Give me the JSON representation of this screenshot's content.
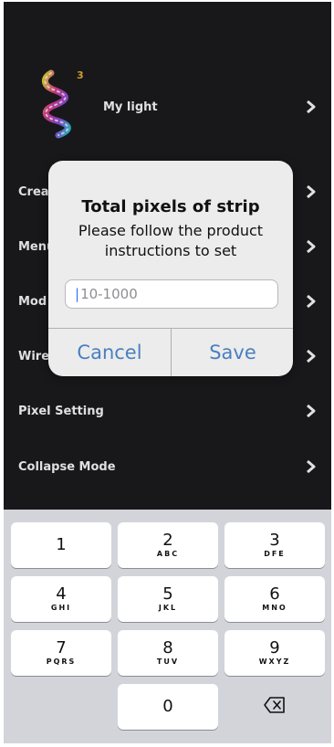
{
  "menu": {
    "my_light": "My light",
    "logo_badge": "3",
    "items": [
      {
        "label": "Crea"
      },
      {
        "label": "Menu"
      },
      {
        "label": "Mod"
      },
      {
        "label": "Wire"
      },
      {
        "label": "Pixel Setting"
      },
      {
        "label": "Collapse Mode"
      }
    ]
  },
  "dialog": {
    "title": "Total pixels of strip",
    "message": "Please follow the product instructions to set",
    "input_placeholder": "10-1000",
    "input_value": "",
    "cancel_label": "Cancel",
    "save_label": "Save"
  },
  "keypad": {
    "keys": [
      {
        "num": "1",
        "letters": ""
      },
      {
        "num": "2",
        "letters": "ABC"
      },
      {
        "num": "3",
        "letters": "DFE"
      },
      {
        "num": "4",
        "letters": "GHI"
      },
      {
        "num": "5",
        "letters": "JKL"
      },
      {
        "num": "6",
        "letters": "MNO"
      },
      {
        "num": "7",
        "letters": "PQRS"
      },
      {
        "num": "8",
        "letters": "TUV"
      },
      {
        "num": "9",
        "letters": "WXYZ"
      },
      {
        "num": "0",
        "letters": ""
      }
    ],
    "backspace_icon": "delete-backspace-icon"
  },
  "colors": {
    "background": "#1c1c1e",
    "dialog_bg": "#ececec",
    "dialog_button": "#4a7fc1",
    "keypad_bg": "#d2d4d9"
  }
}
